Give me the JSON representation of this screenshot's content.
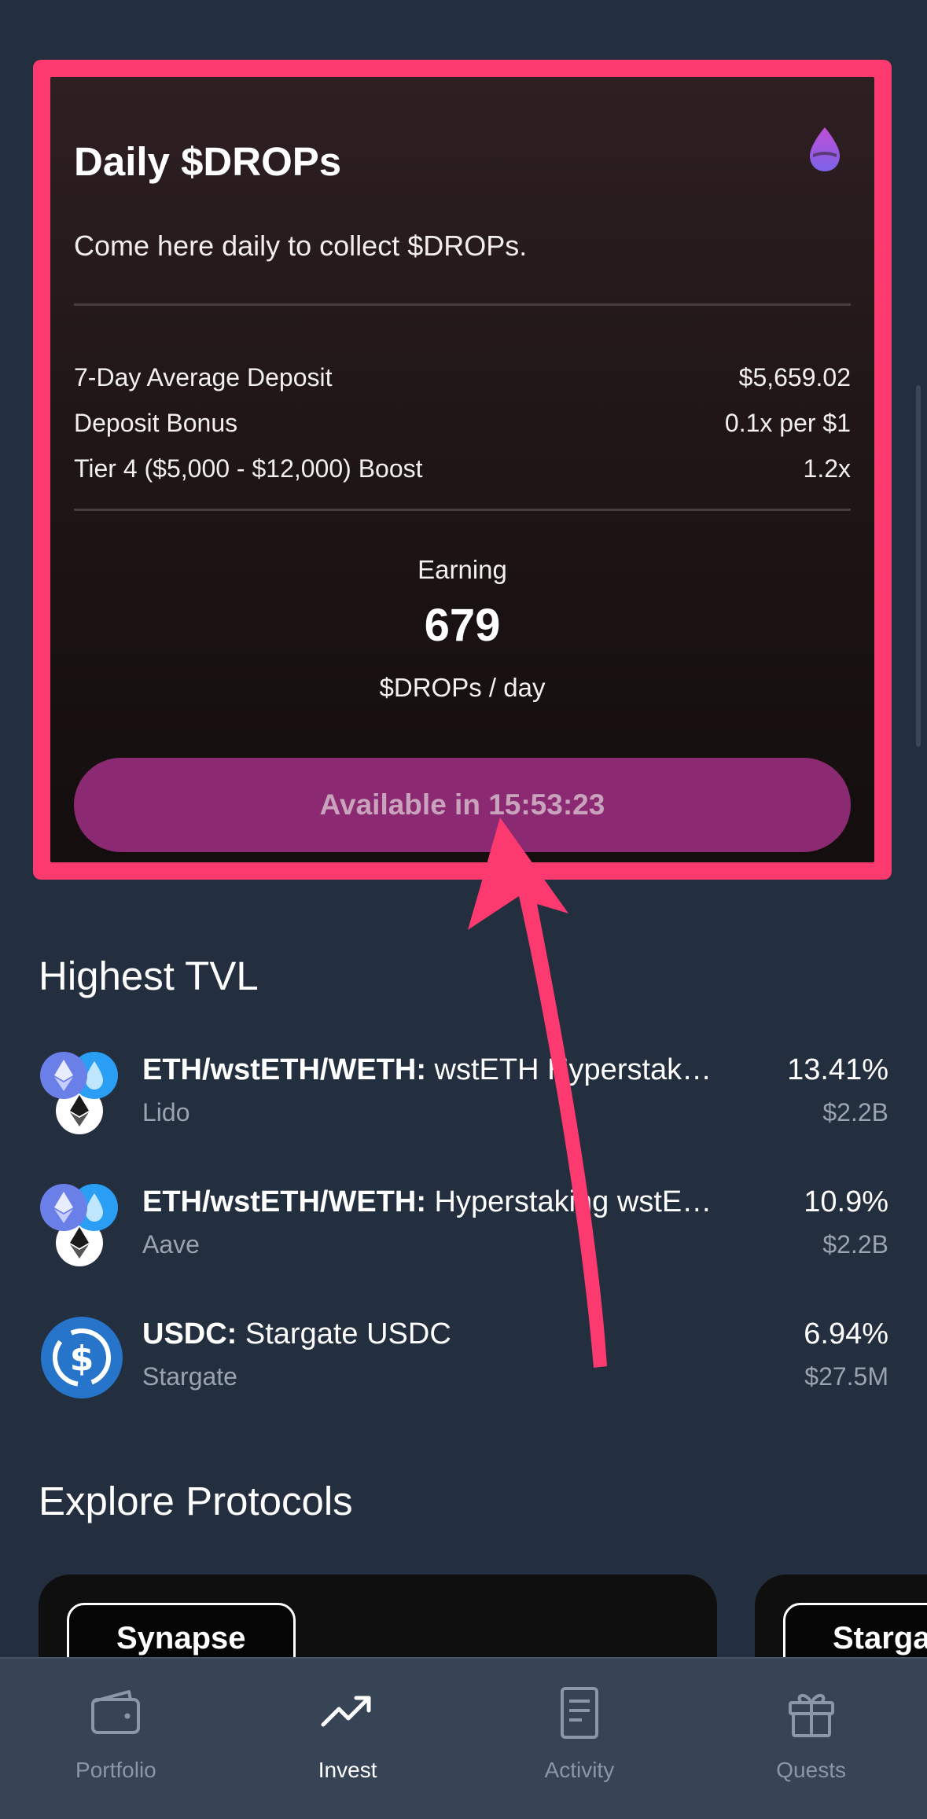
{
  "drops_card": {
    "title": "Daily $DROPs",
    "description": "Come here daily to collect $DROPs.",
    "stats": [
      {
        "label": "7-Day Average Deposit",
        "value": "$5,659.02"
      },
      {
        "label": "Deposit Bonus",
        "value": "0.1x per $1"
      },
      {
        "label": "Tier 4 ($5,000 - $12,000) Boost",
        "value": "1.2x"
      }
    ],
    "earning_label": "Earning",
    "earning_value": "679",
    "earning_unit": "$DROPs / day",
    "button_label": "Available in 15:53:23",
    "icon": "drop-icon"
  },
  "highest_tvl": {
    "title": "Highest TVL",
    "items": [
      {
        "pair": "ETH/wstETH/WETH:",
        "name": "wstETH Hyperstak…",
        "source": "Lido",
        "apy": "13.41%",
        "tvl": "$2.2B",
        "icon": "eth-stack-icon"
      },
      {
        "pair": "ETH/wstETH/WETH:",
        "name": "Hyperstaking wstE…",
        "source": "Aave",
        "apy": "10.9%",
        "tvl": "$2.2B",
        "icon": "eth-stack-icon"
      },
      {
        "pair": "USDC:",
        "name": "Stargate USDC",
        "source": "Stargate",
        "apy": "6.94%",
        "tvl": "$27.5M",
        "icon": "usdc-icon"
      }
    ]
  },
  "explore": {
    "title": "Explore Protocols",
    "protocols": [
      "Synapse",
      "Starga"
    ]
  },
  "tabbar": {
    "tabs": [
      {
        "label": "Portfolio",
        "icon": "wallet-icon"
      },
      {
        "label": "Invest",
        "icon": "trending-up-icon"
      },
      {
        "label": "Activity",
        "icon": "document-icon"
      },
      {
        "label": "Quests",
        "icon": "gift-icon"
      }
    ],
    "active": "Invest"
  },
  "colors": {
    "background": "#232f3e",
    "highlight": "#fc3a6f",
    "button": "#8b2a73",
    "tabbar": "#364455"
  }
}
